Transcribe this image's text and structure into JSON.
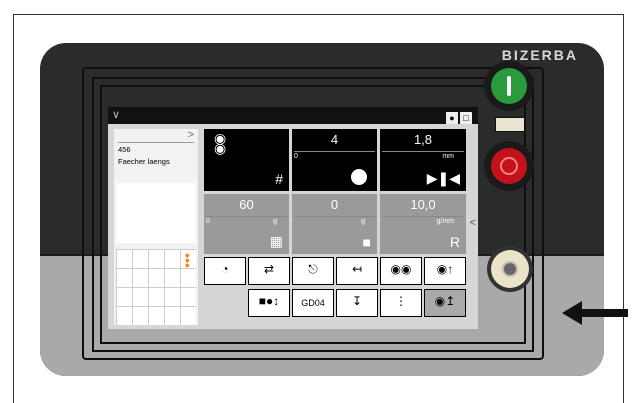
{
  "device": {
    "brand": "BIZERBA"
  },
  "topbar": {
    "menu_icon": "chevron-down-icon",
    "user_icon": "user-icon",
    "book_icon": "book-icon"
  },
  "article": {
    "plu": "456",
    "name": "Faecher laengs"
  },
  "tiles_row1": [
    {
      "id": "stack-mode",
      "value": "",
      "icon": "grid-icon"
    },
    {
      "id": "slice-count",
      "value": "4",
      "sub": "0",
      "icon": "circle-icon"
    },
    {
      "id": "thickness",
      "value": "1,8",
      "unit": "mm",
      "icon": "thickness-icon"
    }
  ],
  "tiles_row2": [
    {
      "id": "weight-target",
      "value": "60",
      "sub": "0",
      "unit": "g",
      "icon": "weight-grid-icon"
    },
    {
      "id": "weight-tare",
      "value": "0",
      "unit": "g",
      "icon": "weight-lock-icon"
    },
    {
      "id": "weight-per-mm",
      "value": "10,0",
      "unit": "g/mm",
      "icon": "weight-r-icon"
    }
  ],
  "buttons_row1": [
    "pie-icon",
    "swap-icon",
    "carriage-icon",
    "width-icon",
    "double-circle-icon",
    "stack-settings-icon"
  ],
  "buttons_row2": {
    "gd_label": "GD04"
  },
  "colors": {
    "accent": "#f08a1c",
    "green": "#2a9a3e",
    "red": "#c2121b"
  }
}
